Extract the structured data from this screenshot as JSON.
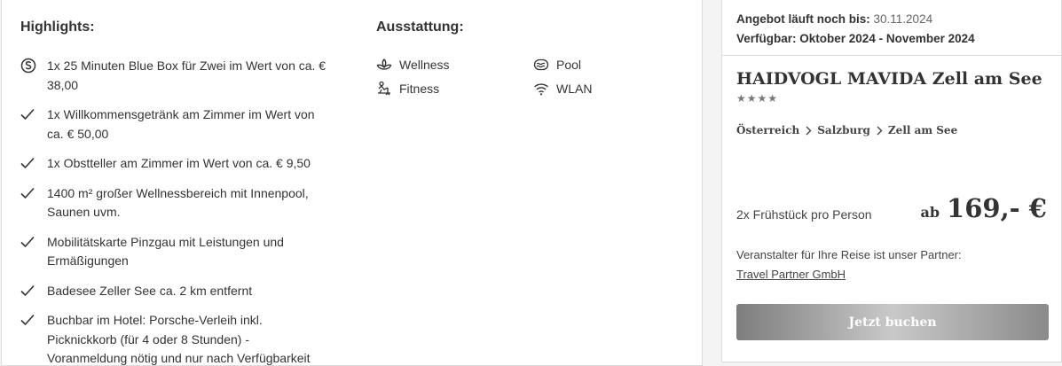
{
  "highlights": {
    "title": "Highlights:",
    "items": [
      {
        "icon": "special-offer-icon",
        "text": "1x 25 Minuten Blue Box für Zwei im Wert von ca. € 38,00"
      },
      {
        "icon": "check-icon",
        "text": "1x Willkommensgetränk am Zimmer im Wert von ca. € 50,00"
      },
      {
        "icon": "check-icon",
        "text": "1x Obstteller am Zimmer im Wert von ca. € 9,50"
      },
      {
        "icon": "check-icon",
        "text": "1400 m² großer Wellnessbereich mit Innenpool, Saunen uvm."
      },
      {
        "icon": "check-icon",
        "text": "Mobilitätskarte Pinzgau mit Leistungen und Ermäßigungen"
      },
      {
        "icon": "check-icon",
        "text": "Badesee Zeller See ca. 2 km entfernt"
      },
      {
        "icon": "check-icon",
        "text": "Buchbar im Hotel: Porsche-Verleih inkl. Picknickkorb (für 4 oder 8 Stunden) - Voranmeldung nötig und nur nach Verfügbarkeit"
      }
    ]
  },
  "amenities": {
    "title": "Ausstattung:",
    "items": [
      {
        "icon": "lotus-icon",
        "label": "Wellness"
      },
      {
        "icon": "pool-icon",
        "label": "Pool"
      },
      {
        "icon": "fitness-icon",
        "label": "Fitness"
      },
      {
        "icon": "wifi-icon",
        "label": "WLAN"
      }
    ]
  },
  "offer": {
    "expiry_label": "Angebot läuft noch bis:",
    "expiry_value": "30.11.2024",
    "availability_label": "Verfügbar:",
    "availability_value": "Oktober 2024 - November 2024",
    "hotel_name": "HAIDVOGL MAVIDA Zell am See",
    "stars": "★★★★",
    "star_count": 4,
    "breadcrumb": [
      "Österreich",
      "Salzburg",
      "Zell am See"
    ],
    "board": "2x Frühstück pro Person",
    "price_prefix": "ab",
    "price": "169,- €",
    "partner_text": "Veranstalter für Ihre Reise ist unser Partner:",
    "partner_link": "Travel Partner GmbH",
    "book_label": "Jetzt buchen"
  },
  "colors": {
    "text": "#333333",
    "border": "#dcdcdc",
    "button_gradient": [
      "#7d7d7d",
      "#c9c9c9",
      "#8a8a8a"
    ]
  }
}
